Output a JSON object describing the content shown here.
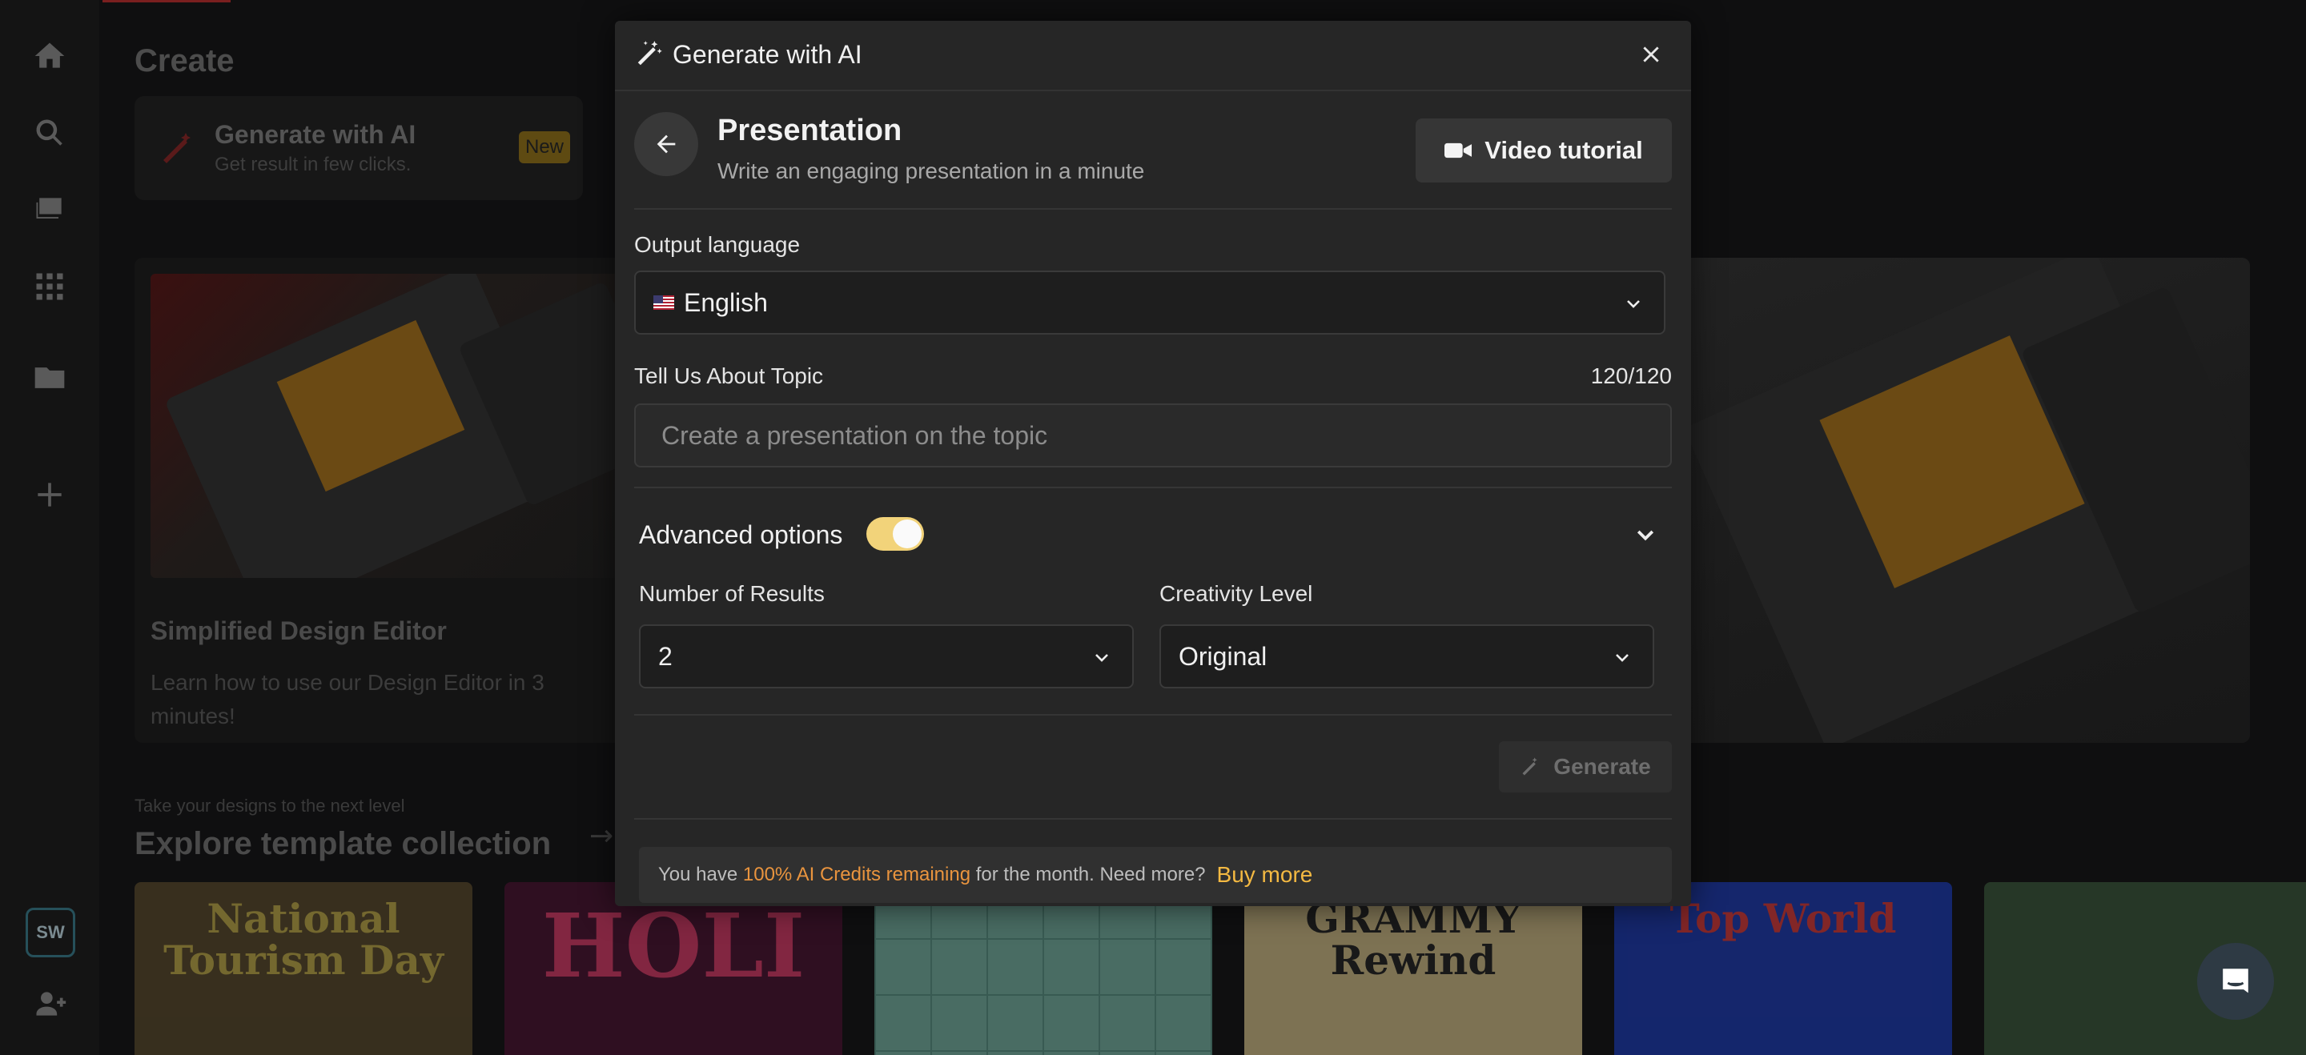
{
  "background": {
    "create_title": "Create",
    "generate_card": {
      "title": "Generate with AI",
      "subtitle": "Get result in few clicks.",
      "badge": "New"
    },
    "hero": {
      "title": "Simplified Design Editor",
      "description": "Learn how to use our Design Editor in 3 minutes!"
    },
    "explore": {
      "kicker": "Take your designs to the next level",
      "title": "Explore template collection"
    },
    "templates": [
      {
        "text": "National Tourism Day",
        "bg": "#5a4a2a",
        "color": "#c8b24a"
      },
      {
        "text": "HOLI",
        "bg": "#4a1030",
        "color": "#e03a6a"
      },
      {
        "text": "",
        "bg": "#7ab8a8",
        "color": "#ffffff"
      },
      {
        "text": "GRAMMY Rewind",
        "bg": "#d8c48a",
        "color": "#222222"
      },
      {
        "text": "Top World",
        "bg": "#1a3ab8",
        "color": "#e03a3a"
      },
      {
        "text": "",
        "bg": "#3a5a3a",
        "color": "#ffffff"
      }
    ],
    "user_initials": "SW"
  },
  "modal": {
    "title": "Generate with AI",
    "section_title": "Presentation",
    "section_subtitle": "Write an engaging presentation in a minute",
    "video_tutorial": "Video tutorial",
    "output_language": {
      "label": "Output language",
      "value": "English"
    },
    "topic": {
      "label": "Tell Us About Topic",
      "counter": "120/120",
      "placeholder": "Create a presentation on the topic"
    },
    "advanced": {
      "label": "Advanced options",
      "enabled": true
    },
    "num_results": {
      "label": "Number of Results",
      "value": "2"
    },
    "creativity": {
      "label": "Creativity Level",
      "value": "Original"
    },
    "generate": "Generate",
    "credits": {
      "prefix": "You have ",
      "highlight": "100% AI Credits remaining",
      "suffix": " for the month. Need more?",
      "buy": "Buy more"
    }
  },
  "colors": {
    "accent": "#f4b942",
    "toggle_on": "#f2d37a",
    "credits_highlight": "#e9943e"
  }
}
